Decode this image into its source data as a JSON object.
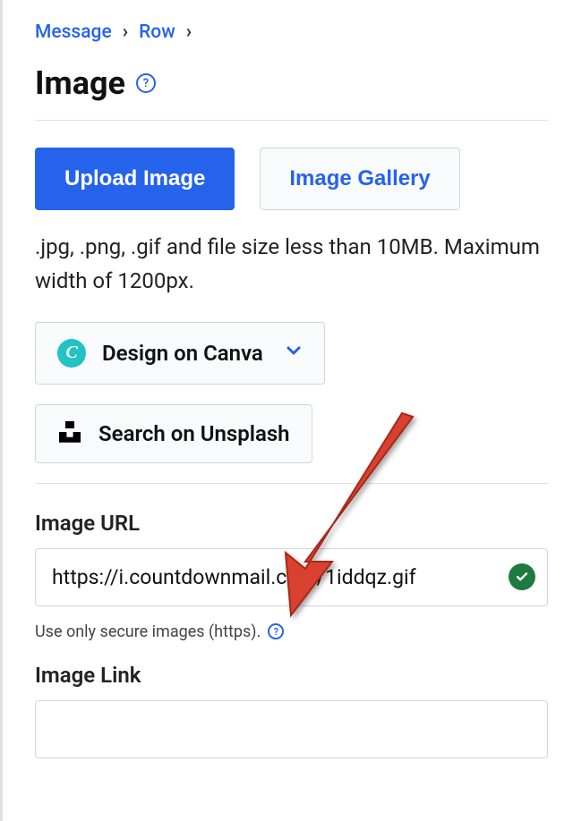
{
  "breadcrumb": {
    "message": "Message",
    "row": "Row"
  },
  "page_title": "Image",
  "buttons": {
    "upload": "Upload Image",
    "gallery": "Image Gallery"
  },
  "upload_hint": ".jpg, .png, .gif and file size less than 10MB. Maximum width of 1200px.",
  "actions": {
    "canva": "Design on Canva",
    "unsplash": "Search on Unsplash"
  },
  "image_url": {
    "label": "Image URL",
    "value": "https://i.countdownmail.com/1iddqz.gif",
    "hint": "Use only secure images (https)."
  },
  "image_link": {
    "label": "Image Link",
    "value": ""
  }
}
